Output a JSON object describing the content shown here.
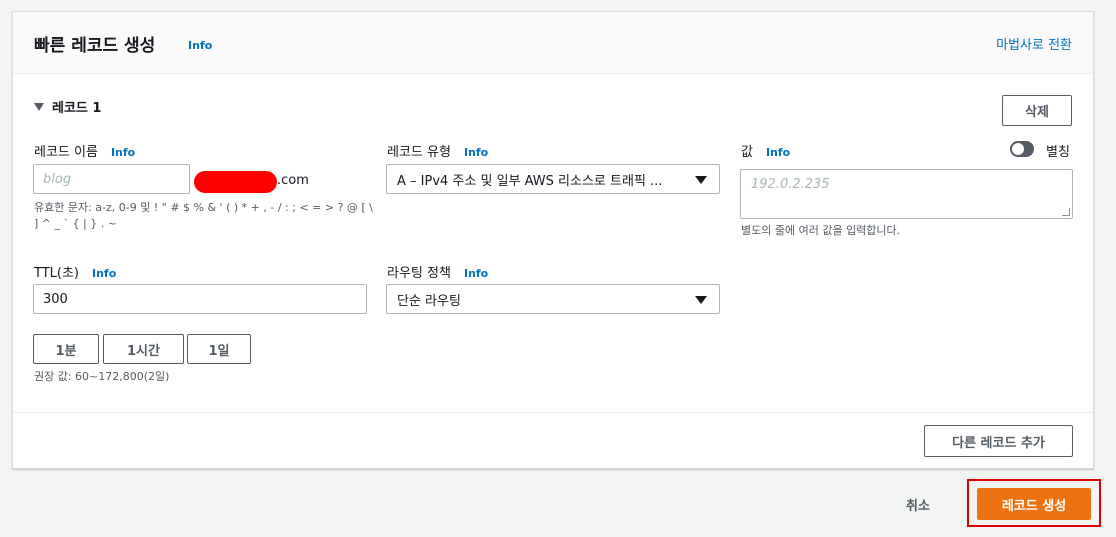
{
  "header": {
    "title": "빠른 레코드 생성",
    "info": "Info",
    "wizard_link": "마법사로 전환"
  },
  "record": {
    "section_label": "레코드 1",
    "delete_label": "삭제",
    "name": {
      "label": "레코드 이름",
      "info": "Info",
      "placeholder": "blog",
      "suffix": ".com",
      "hint_line1": "유효한 문자: a-z, 0-9 및 ! \" # $ % & ' ( ) * + , - / : ; < = > ? @ [ \\",
      "hint_line2": "] ^ _ ` { | } . ~"
    },
    "type": {
      "label": "레코드 유형",
      "info": "Info",
      "value": "A – IPv4 주소 및 일부 AWS 리소스로 트래픽 ..."
    },
    "value": {
      "label": "값",
      "info": "Info",
      "placeholder": "192.0.2.235",
      "hint": "별도의 줄에 여러 값을 입력합니다.",
      "alias_label": "별칭",
      "alias_enabled": false
    },
    "ttl": {
      "label": "TTL(초)",
      "info": "Info",
      "value": "300",
      "presets": [
        "1분",
        "1시간",
        "1일"
      ],
      "hint": "권장 값: 60~172,800(2일)"
    },
    "routing": {
      "label": "라우팅 정책",
      "info": "Info",
      "value": "단순 라우팅"
    }
  },
  "footer": {
    "add_record": "다른 레코드 추가",
    "cancel": "취소",
    "create": "레코드 생성"
  },
  "colors": {
    "link": "#0073bb",
    "primary_button": "#ec7211",
    "highlight_border": "#e00000",
    "redaction": "#ff0000"
  }
}
